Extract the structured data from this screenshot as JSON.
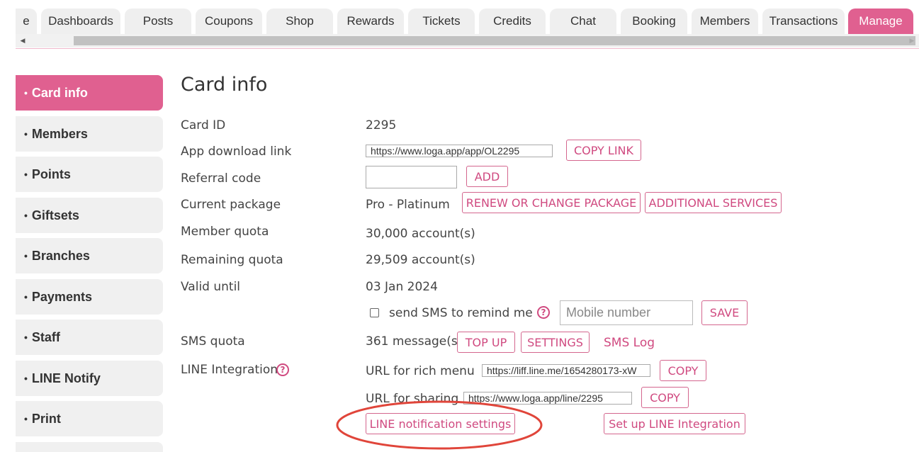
{
  "tabs": [
    {
      "label": "e"
    },
    {
      "label": "Dashboards"
    },
    {
      "label": "Posts"
    },
    {
      "label": "Coupons"
    },
    {
      "label": "Shop"
    },
    {
      "label": "Rewards"
    },
    {
      "label": "Tickets"
    },
    {
      "label": "Credits"
    },
    {
      "label": "Chat"
    },
    {
      "label": "Booking"
    },
    {
      "label": "Members"
    },
    {
      "label": "Transactions"
    },
    {
      "label": "Manage"
    }
  ],
  "sidebar": {
    "bullet": "•",
    "items": [
      {
        "label": "Card info"
      },
      {
        "label": "Members"
      },
      {
        "label": "Points"
      },
      {
        "label": "Giftsets"
      },
      {
        "label": "Branches"
      },
      {
        "label": "Payments"
      },
      {
        "label": "Staff"
      },
      {
        "label": "LINE Notify"
      },
      {
        "label": "Print"
      }
    ]
  },
  "main": {
    "title": "Card info",
    "card_id": {
      "label": "Card ID",
      "value": "2295"
    },
    "app_link": {
      "label": "App download link",
      "url": "https://www.loga.app/app/OL2295",
      "copy_button": "COPY LINK"
    },
    "referral": {
      "label": "Referral code",
      "value": "",
      "add_button": "ADD"
    },
    "package": {
      "label": "Current package",
      "value": "Pro - Platinum",
      "renew_button": "RENEW OR CHANGE PACKAGE",
      "services_button": "ADDITIONAL SERVICES"
    },
    "member_quota": {
      "label": "Member quota",
      "value": "30,000 account(s)"
    },
    "remaining_quota": {
      "label": "Remaining quota",
      "value": "29,509 account(s)"
    },
    "valid_until": {
      "label": "Valid until",
      "value": "03 Jan 2024"
    },
    "sms_remind": {
      "label": "send SMS to remind me",
      "help": "?",
      "mobile_placeholder": "Mobile number",
      "save_button": "SAVE"
    },
    "sms_quota": {
      "label": "SMS quota",
      "value": "361 message(s)",
      "topup_button": "TOP UP",
      "settings_button": "SETTINGS",
      "log_link": "SMS Log"
    },
    "line": {
      "label": "LINE Integration",
      "help": "?",
      "rich_menu_label": "URL for rich menu",
      "rich_menu_url": "https://liff.line.me/1654280173-xW",
      "rich_copy_button": "COPY",
      "sharing_label": "URL for sharing",
      "sharing_url": "https://www.loga.app/line/2295",
      "sharing_copy_button": "COPY",
      "notify_settings_button": "LINE notification settings",
      "setup_button": "Set up LINE Integration"
    }
  },
  "colors": {
    "accent": "#e06090",
    "highlight": "#e0453a"
  }
}
